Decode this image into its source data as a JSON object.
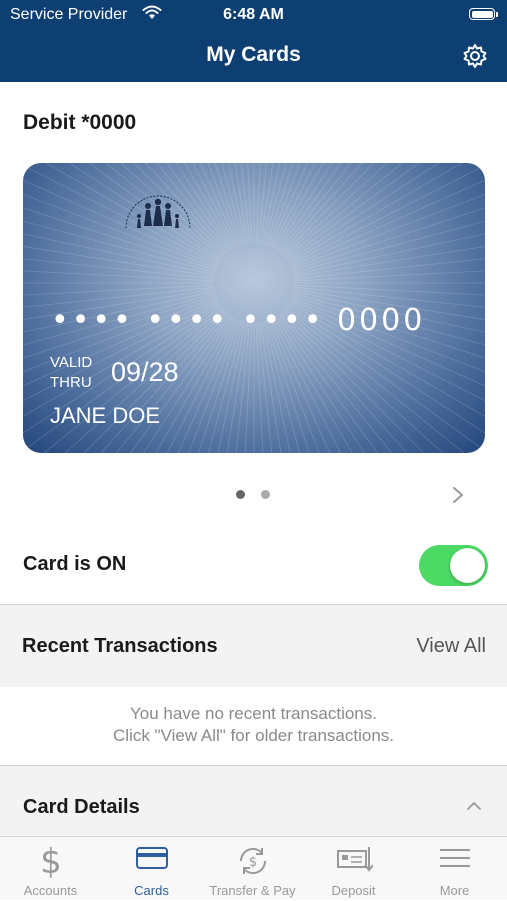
{
  "status_bar": {
    "carrier": "Service Provider",
    "time": "6:48 AM"
  },
  "nav": {
    "title": "My Cards"
  },
  "card_section": {
    "title": "Debit *0000",
    "card": {
      "masked_number": "•••• •••• •••• 0000",
      "valid_line1": "VALID",
      "valid_line2": "THRU",
      "expiry": "09/28",
      "holder": "JANE DOE"
    },
    "pager": {
      "count": 2,
      "active_index": 0
    }
  },
  "card_toggle": {
    "label": "Card is ON",
    "on": true
  },
  "recent": {
    "title": "Recent Transactions",
    "view_all": "View All",
    "empty_line1": "You have no recent transactions.",
    "empty_line2": "Click \"View All\" for older transactions."
  },
  "details": {
    "title": "Card Details"
  },
  "tabs": [
    {
      "label": "Accounts",
      "icon": "dollar-icon"
    },
    {
      "label": "Cards",
      "icon": "card-icon",
      "active": true
    },
    {
      "label": "Transfer & Pay",
      "icon": "transfer-icon"
    },
    {
      "label": "Deposit",
      "icon": "deposit-icon"
    },
    {
      "label": "More",
      "icon": "menu-icon"
    }
  ],
  "colors": {
    "nav": "#0e3f73",
    "toggle_on": "#4cd964",
    "tab_active": "#2e5f9e",
    "tab_inactive": "#999999"
  }
}
